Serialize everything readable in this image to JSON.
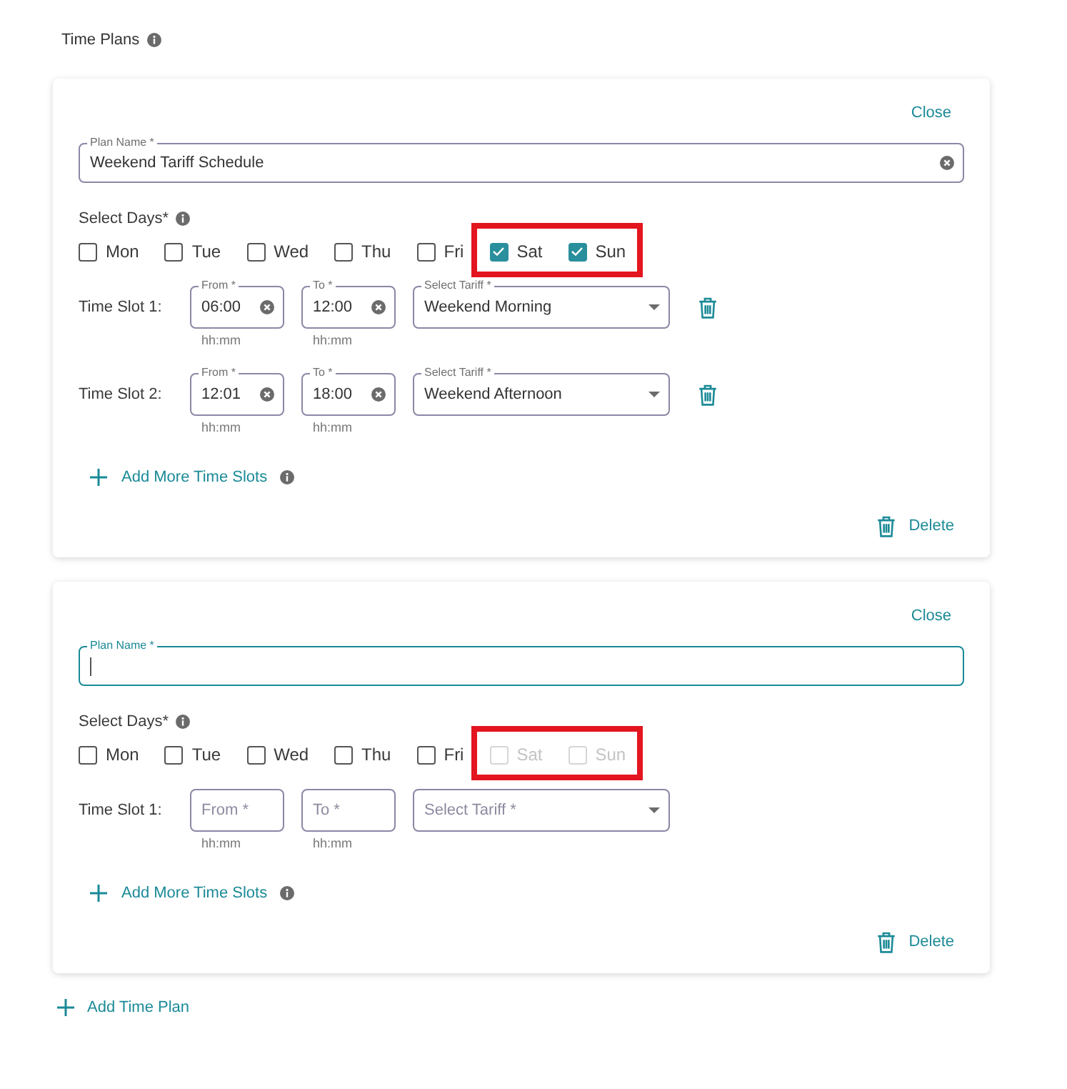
{
  "header": {
    "title": "Time Plans"
  },
  "plans": [
    {
      "close": "Close",
      "plan_name": {
        "label": "Plan Name *",
        "value": "Weekend Tariff Schedule",
        "focused": false
      },
      "days_label": "Select Days*",
      "days": [
        {
          "label": "Mon",
          "checked": false,
          "disabled": false,
          "highlighted": false
        },
        {
          "label": "Tue",
          "checked": false,
          "disabled": false,
          "highlighted": false
        },
        {
          "label": "Wed",
          "checked": false,
          "disabled": false,
          "highlighted": false
        },
        {
          "label": "Thu",
          "checked": false,
          "disabled": false,
          "highlighted": false
        },
        {
          "label": "Fri",
          "checked": false,
          "disabled": false,
          "highlighted": false
        },
        {
          "label": "Sat",
          "checked": true,
          "disabled": false,
          "highlighted": true
        },
        {
          "label": "Sun",
          "checked": true,
          "disabled": false,
          "highlighted": true
        }
      ],
      "time_slots": [
        {
          "label": "Time Slot 1:",
          "from": {
            "label": "From *",
            "value": "06:00",
            "hint": "hh:mm"
          },
          "to": {
            "label": "To *",
            "value": "12:00",
            "hint": "hh:mm"
          },
          "tariff": {
            "label": "Select Tariff *",
            "value": "Weekend Morning"
          },
          "removable": true
        },
        {
          "label": "Time Slot 2:",
          "from": {
            "label": "From *",
            "value": "12:01",
            "hint": "hh:mm"
          },
          "to": {
            "label": "To *",
            "value": "18:00",
            "hint": "hh:mm"
          },
          "tariff": {
            "label": "Select Tariff *",
            "value": "Weekend Afternoon"
          },
          "removable": true
        }
      ],
      "add_slots": "Add More Time Slots",
      "delete": "Delete"
    },
    {
      "close": "Close",
      "plan_name": {
        "label": "Plan Name *",
        "focused": true
      },
      "days_label": "Select Days*",
      "days": [
        {
          "label": "Mon",
          "checked": false,
          "disabled": false,
          "highlighted": false
        },
        {
          "label": "Tue",
          "checked": false,
          "disabled": false,
          "highlighted": false
        },
        {
          "label": "Wed",
          "checked": false,
          "disabled": false,
          "highlighted": false
        },
        {
          "label": "Thu",
          "checked": false,
          "disabled": false,
          "highlighted": false
        },
        {
          "label": "Fri",
          "checked": false,
          "disabled": false,
          "highlighted": false
        },
        {
          "label": "Sat",
          "checked": false,
          "disabled": true,
          "highlighted": true
        },
        {
          "label": "Sun",
          "checked": false,
          "disabled": true,
          "highlighted": true
        }
      ],
      "time_slots": [
        {
          "label": "Time Slot 1:",
          "from": {
            "placeholder": "From *",
            "hint": "hh:mm"
          },
          "to": {
            "placeholder": "To *",
            "hint": "hh:mm"
          },
          "tariff": {
            "placeholder": "Select Tariff *"
          },
          "removable": false
        }
      ],
      "add_slots": "Add More Time Slots",
      "delete": "Delete"
    }
  ],
  "add_plan": "Add Time Plan"
}
